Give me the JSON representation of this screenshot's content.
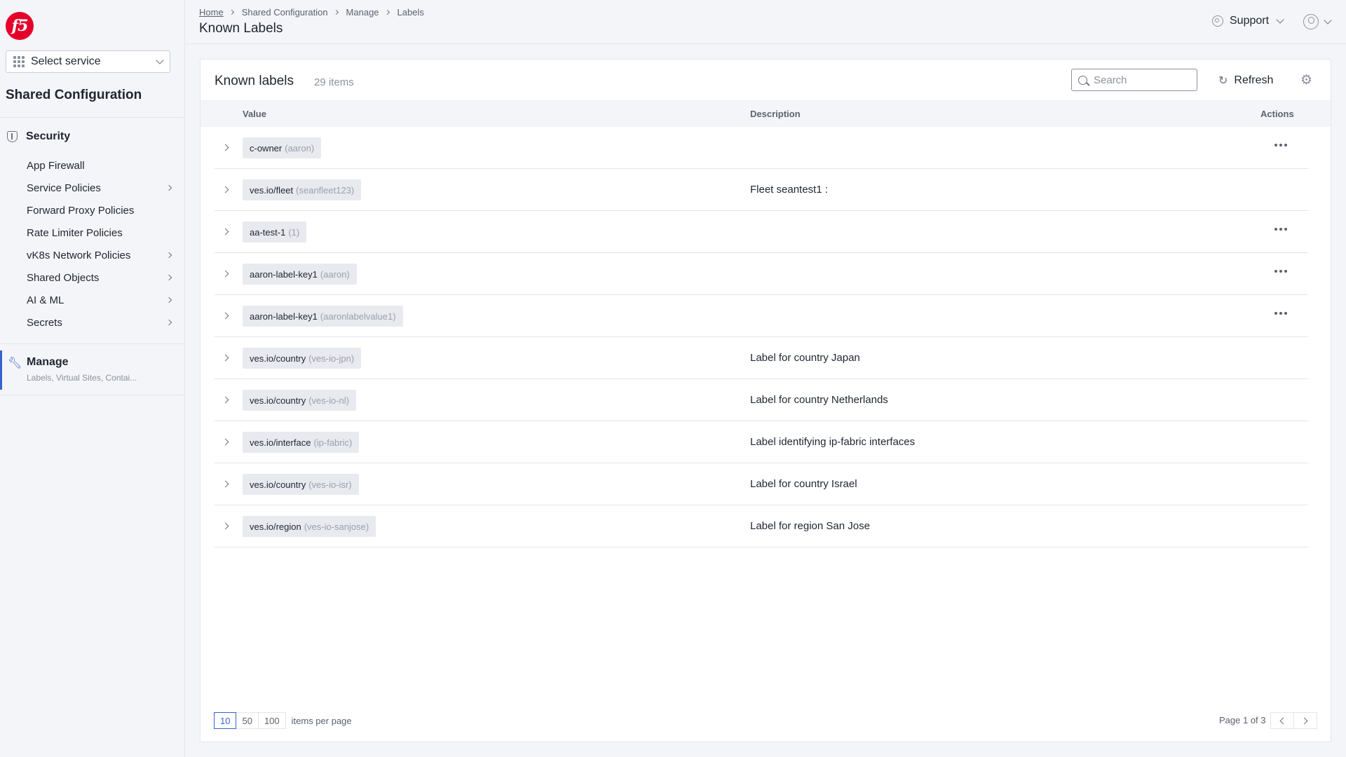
{
  "brand": {
    "logo_text": "f5",
    "accent": "#e4002b",
    "primary": "#3762ce"
  },
  "sidebar": {
    "service_select": "Select service",
    "title": "Shared Configuration",
    "section": {
      "label": "Security",
      "icon": "shield-icon"
    },
    "items": [
      {
        "label": "App Firewall",
        "has_children": false
      },
      {
        "label": "Service Policies",
        "has_children": true
      },
      {
        "label": "Forward Proxy Policies",
        "has_children": false
      },
      {
        "label": "Rate Limiter Policies",
        "has_children": false
      },
      {
        "label": "vK8s Network Policies",
        "has_children": true
      },
      {
        "label": "Shared Objects",
        "has_children": true
      },
      {
        "label": "AI & ML",
        "has_children": true
      },
      {
        "label": "Secrets",
        "has_children": true
      }
    ],
    "manage": {
      "label": "Manage",
      "subtitle": "Labels, Virtual Sites, Contai...",
      "icon": "wrench-icon"
    }
  },
  "header": {
    "breadcrumbs": [
      "Home",
      "Shared Configuration",
      "Manage",
      "Labels"
    ],
    "title": "Known Labels",
    "support_label": "Support",
    "user_icon": "user-icon"
  },
  "card": {
    "title": "Known labels",
    "count": "29 items",
    "search_placeholder": "Search",
    "refresh_label": "Refresh",
    "settings_icon": "gear-icon"
  },
  "table": {
    "columns": {
      "value": "Value",
      "description": "Description",
      "actions": "Actions"
    },
    "rows": [
      {
        "key": "c-owner",
        "value": "(aaron)",
        "description": "",
        "has_actions": true
      },
      {
        "key": "ves.io/fleet",
        "value": "(seanfleet123)",
        "description": "Fleet seantest1 :",
        "has_actions": false
      },
      {
        "key": "aa-test-1",
        "value": "(1)",
        "description": "",
        "has_actions": true
      },
      {
        "key": "aaron-label-key1",
        "value": "(aaron)",
        "description": "",
        "has_actions": true
      },
      {
        "key": "aaron-label-key1",
        "value": "(aaronlabelvalue1)",
        "description": "",
        "has_actions": true
      },
      {
        "key": "ves.io/country",
        "value": "(ves-io-jpn)",
        "description": "Label for country Japan",
        "has_actions": false
      },
      {
        "key": "ves.io/country",
        "value": "(ves-io-nl)",
        "description": "Label for country Netherlands",
        "has_actions": false
      },
      {
        "key": "ves.io/interface",
        "value": "(ip-fabric)",
        "description": "Label identifying ip-fabric interfaces",
        "has_actions": false
      },
      {
        "key": "ves.io/country",
        "value": "(ves-io-isr)",
        "description": "Label for country Israel",
        "has_actions": false
      },
      {
        "key": "ves.io/region",
        "value": "(ves-io-sanjose)",
        "description": "Label for region San Jose",
        "has_actions": false
      }
    ]
  },
  "pagination": {
    "sizes": [
      "10",
      "50",
      "100"
    ],
    "active_size": "10",
    "per_page_label": "items per page",
    "page_info": "Page 1 of 3"
  }
}
